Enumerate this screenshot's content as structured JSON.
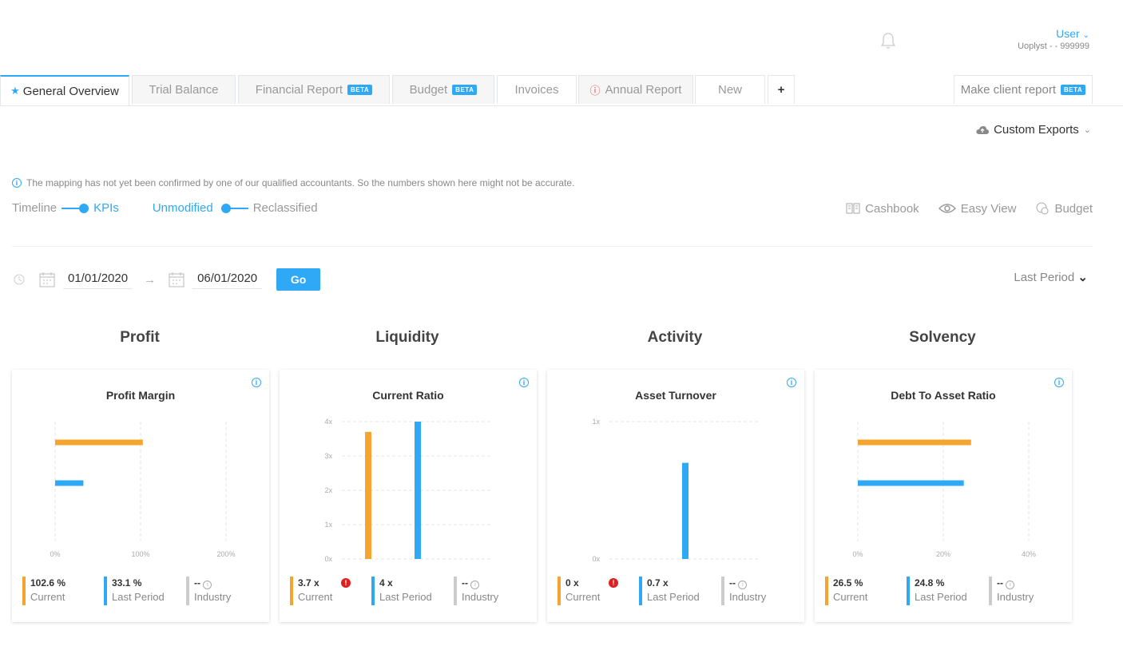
{
  "header": {
    "user_name": "User",
    "user_sub": "Uoplyst - - 999999"
  },
  "tabs": [
    {
      "label": "General Overview",
      "active": true,
      "icon": "star-icon"
    },
    {
      "label": "Trial Balance"
    },
    {
      "label": "Financial Report",
      "badge": "BETA"
    },
    {
      "label": "Budget",
      "badge": "BETA"
    },
    {
      "label": "Invoices"
    },
    {
      "label": "Annual Report",
      "icon": "warning-icon"
    },
    {
      "label": "New"
    },
    {
      "label": "+"
    }
  ],
  "make_client_report": {
    "label": "Make client report",
    "badge": "BETA"
  },
  "custom_exports": "Custom Exports",
  "notice": "The mapping has not yet been confirmed by one of our qualified accountants. So the numbers shown here might not be accurate.",
  "toggles": {
    "timeline": "Timeline",
    "kpis": "KPIs",
    "unmodified": "Unmodified",
    "reclassified": "Reclassified"
  },
  "views": {
    "cashbook": "Cashbook",
    "easy_view": "Easy View",
    "budget": "Budget"
  },
  "dates": {
    "start": "01/01/2020",
    "end": "06/01/2020",
    "go": "Go",
    "period": "Last Period"
  },
  "sections": [
    "Profit",
    "Liquidity",
    "Activity",
    "Solvency"
  ],
  "colors": {
    "current": "#f5a42f",
    "last": "#2fa9f5",
    "industry": "#cccccc",
    "accent": "#2fa9f5"
  },
  "legend_labels": {
    "current": "Current",
    "last": "Last Period",
    "industry": "Industry"
  },
  "chart_data": [
    {
      "type": "bar",
      "orientation": "horizontal",
      "title": "Profit Margin",
      "series": [
        {
          "name": "Current",
          "values": [
            102.6
          ]
        },
        {
          "name": "Last Period",
          "values": [
            33.1
          ]
        }
      ],
      "xlim": [
        0,
        200
      ],
      "xticks": [
        "0%",
        "100%",
        "200%"
      ],
      "legend": {
        "current": "102.6 %",
        "last": "33.1 %",
        "industry": "--"
      }
    },
    {
      "type": "bar",
      "orientation": "vertical",
      "title": "Current Ratio",
      "series": [
        {
          "name": "Current",
          "values": [
            3.7
          ]
        },
        {
          "name": "Last Period",
          "values": [
            4
          ]
        }
      ],
      "ylim": [
        0,
        4
      ],
      "yticks": [
        "0x",
        "1x",
        "2x",
        "3x",
        "4x"
      ],
      "legend": {
        "current": "3.7 x",
        "last": "4 x",
        "industry": "--"
      },
      "alert": true
    },
    {
      "type": "bar",
      "orientation": "vertical",
      "title": "Asset Turnover",
      "series": [
        {
          "name": "Current",
          "values": [
            0
          ]
        },
        {
          "name": "Last Period",
          "values": [
            0.7
          ]
        }
      ],
      "ylim": [
        0,
        1
      ],
      "yticks": [
        "0x",
        "1x"
      ],
      "legend": {
        "current": "0 x",
        "last": "0.7 x",
        "industry": "--"
      },
      "alert": true
    },
    {
      "type": "bar",
      "orientation": "horizontal",
      "title": "Debt To Asset Ratio",
      "series": [
        {
          "name": "Current",
          "values": [
            26.5
          ]
        },
        {
          "name": "Last Period",
          "values": [
            24.8
          ]
        }
      ],
      "xlim": [
        0,
        40
      ],
      "xticks": [
        "0%",
        "20%",
        "40%"
      ],
      "legend": {
        "current": "26.5 %",
        "last": "24.8 %",
        "industry": "--"
      }
    }
  ]
}
